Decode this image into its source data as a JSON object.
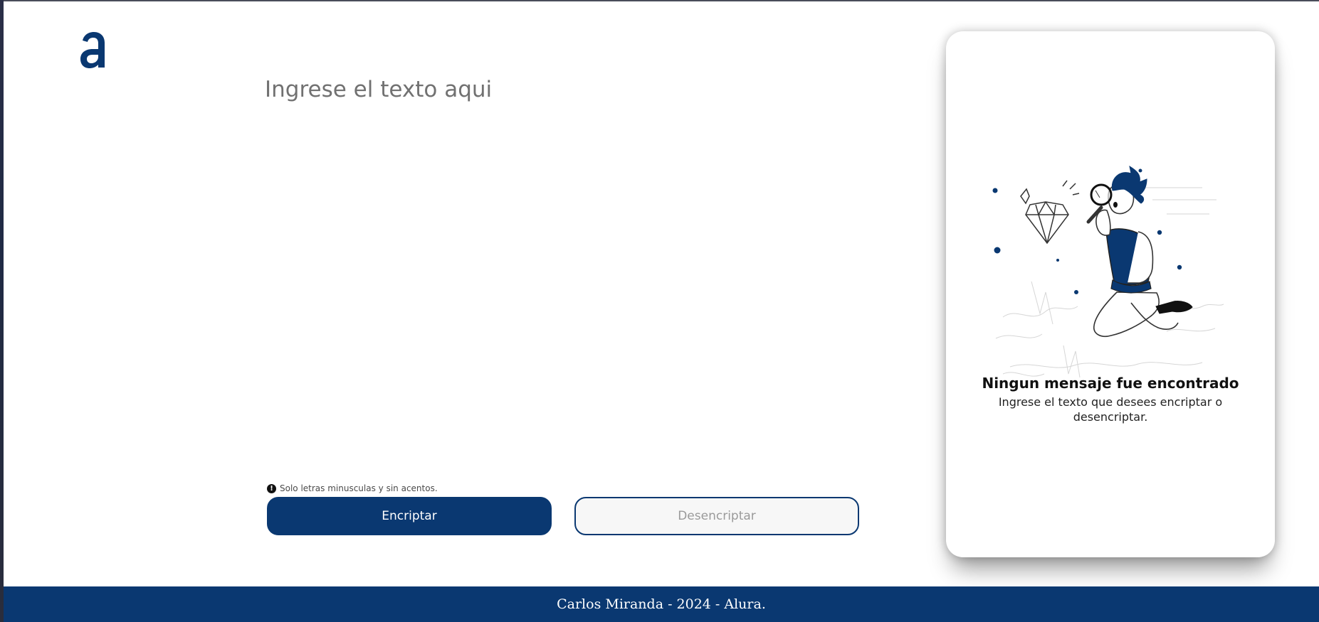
{
  "input": {
    "placeholder": "Ingrese el texto aqui",
    "value": ""
  },
  "hint": {
    "icon": "exclamation-circle-icon",
    "text": "Solo letras minusculas y sin acentos."
  },
  "buttons": {
    "encrypt_label": "Encriptar",
    "decrypt_label": "Desencriptar"
  },
  "output": {
    "title": "Ningun mensaje fue encontrado",
    "subtitle": "Ingrese el texto que desees encriptar o desencriptar."
  },
  "footer": {
    "text": "Carlos Miranda - 2024 - Alura."
  },
  "colors": {
    "brand": "#0a3871",
    "background": "#ffffff",
    "placeholder": "#717171"
  }
}
